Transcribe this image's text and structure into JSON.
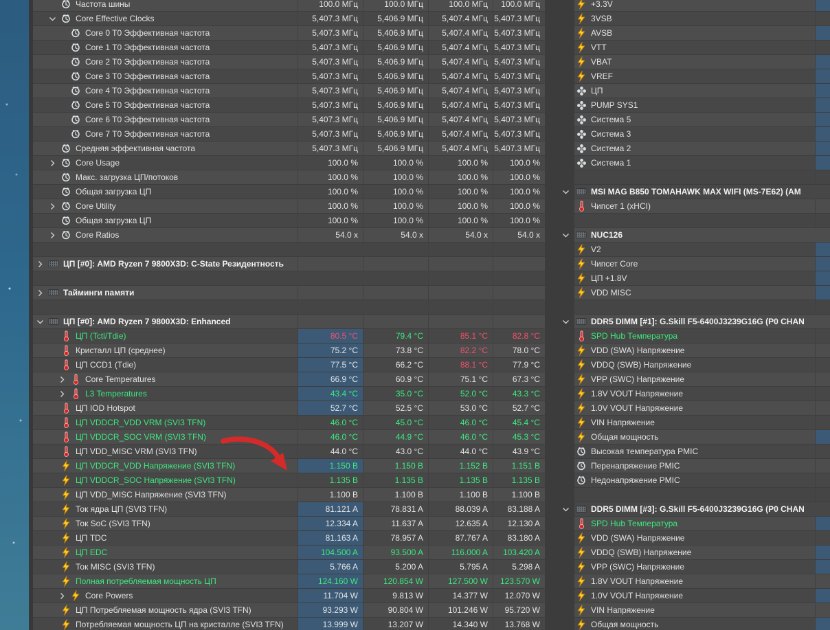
{
  "app": "HWiNFO64 sensor status (Russian locale)",
  "colors": {
    "row_light": "#4d4d4d",
    "row_dark": "#474747",
    "highlight_cell": "#3c5a76",
    "text_default": "#e3e3e3",
    "text_green": "#3ce97e",
    "text_red": "#f2516a",
    "annotation_arrow": "#d42a2a"
  },
  "left_table": {
    "rows": [
      {
        "type": "sensor",
        "icon": "clock",
        "level": "top",
        "label": "Частота шины",
        "values": [
          "100.0 МГц",
          "100.0 МГц",
          "100.0 МГц",
          "100.0 МГц"
        ]
      },
      {
        "type": "sensor",
        "icon": "clock",
        "level": "top",
        "chevron": "expanded",
        "label": "Core Effective Clocks",
        "values": [
          "5,407.3 МГц",
          "5,406.9 МГц",
          "5,407.4 МГц",
          "5,407.3 МГц"
        ]
      },
      {
        "type": "sensor",
        "icon": "clock",
        "level": "child",
        "label": "Core 0 T0 Эффективная частота",
        "values": [
          "5,407.3 МГц",
          "5,406.9 МГц",
          "5,407.4 МГц",
          "5,407.3 МГц"
        ]
      },
      {
        "type": "sensor",
        "icon": "clock",
        "level": "child",
        "label": "Core 1 T0 Эффективная частота",
        "values": [
          "5,407.3 МГц",
          "5,406.9 МГц",
          "5,407.4 МГц",
          "5,407.3 МГц"
        ]
      },
      {
        "type": "sensor",
        "icon": "clock",
        "level": "child",
        "label": "Core 2 T0 Эффективная частота",
        "values": [
          "5,407.3 МГц",
          "5,406.9 МГц",
          "5,407.4 МГц",
          "5,407.3 МГц"
        ]
      },
      {
        "type": "sensor",
        "icon": "clock",
        "level": "child",
        "label": "Core 3 T0 Эффективная частота",
        "values": [
          "5,407.3 МГц",
          "5,406.9 МГц",
          "5,407.4 МГц",
          "5,407.3 МГц"
        ]
      },
      {
        "type": "sensor",
        "icon": "clock",
        "level": "child",
        "label": "Core 4 T0 Эффективная частота",
        "values": [
          "5,407.3 МГц",
          "5,406.9 МГц",
          "5,407.4 МГц",
          "5,407.3 МГц"
        ]
      },
      {
        "type": "sensor",
        "icon": "clock",
        "level": "child",
        "label": "Core 5 T0 Эффективная частота",
        "values": [
          "5,407.3 МГц",
          "5,406.9 МГц",
          "5,407.4 МГц",
          "5,407.3 МГц"
        ]
      },
      {
        "type": "sensor",
        "icon": "clock",
        "level": "child",
        "label": "Core 6 T0 Эффективная частота",
        "values": [
          "5,407.3 МГц",
          "5,406.9 МГц",
          "5,407.4 МГц",
          "5,407.3 МГц"
        ]
      },
      {
        "type": "sensor",
        "icon": "clock",
        "level": "child",
        "label": "Core 7 T0 Эффективная частота",
        "values": [
          "5,407.3 МГц",
          "5,406.9 МГц",
          "5,407.4 МГц",
          "5,407.3 МГц"
        ]
      },
      {
        "type": "sensor",
        "icon": "clock",
        "level": "top",
        "label": "Средняя эффективная частота",
        "values": [
          "5,407.3 МГц",
          "5,406.9 МГц",
          "5,407.4 МГц",
          "5,407.3 МГц"
        ]
      },
      {
        "type": "sensor",
        "icon": "clock",
        "level": "top",
        "chevron": "collapsed",
        "label": "Core Usage",
        "values": [
          "100.0 %",
          "100.0 %",
          "100.0 %",
          "100.0 %"
        ]
      },
      {
        "type": "sensor",
        "icon": "clock",
        "level": "top",
        "label": "Макс. загрузка ЦП/потоков",
        "values": [
          "100.0 %",
          "100.0 %",
          "100.0 %",
          "100.0 %"
        ]
      },
      {
        "type": "sensor",
        "icon": "clock",
        "level": "top",
        "label": "Общая загрузка ЦП",
        "values": [
          "100.0 %",
          "100.0 %",
          "100.0 %",
          "100.0 %"
        ]
      },
      {
        "type": "sensor",
        "icon": "clock",
        "level": "top",
        "chevron": "collapsed",
        "label": "Core Utility",
        "values": [
          "100.0 %",
          "100.0 %",
          "100.0 %",
          "100.0 %"
        ]
      },
      {
        "type": "sensor",
        "icon": "clock",
        "level": "top",
        "label": "Общая загрузка ЦП",
        "values": [
          "100.0 %",
          "100.0 %",
          "100.0 %",
          "100.0 %"
        ]
      },
      {
        "type": "sensor",
        "icon": "clock",
        "level": "top",
        "chevron": "collapsed",
        "label": "Core Ratios",
        "values": [
          "54.0 x",
          "54.0 x",
          "54.0 x",
          "54.0 x"
        ]
      },
      {
        "type": "spacer"
      },
      {
        "type": "section",
        "icon": "chip",
        "chevron": "collapsed",
        "label": "ЦП [#0]: AMD Ryzen 7 9800X3D: C-State Резидентность"
      },
      {
        "type": "spacer"
      },
      {
        "type": "section",
        "icon": "chip",
        "chevron": "collapsed",
        "label": "Тайминги памяти"
      },
      {
        "type": "spacer"
      },
      {
        "type": "section",
        "icon": "chip",
        "chevron": "expanded",
        "label": "ЦП [#0]: AMD Ryzen 7 9800X3D: Enhanced"
      },
      {
        "type": "sensor",
        "icon": "thermometer",
        "level": "top",
        "color": "green",
        "highlight": true,
        "label": "ЦП (Tctl/Tdie)",
        "values": [
          "80.5 °C",
          "79.4 °C",
          "85.1 °C",
          "82.8 °C"
        ],
        "value_colors": [
          "red",
          "green",
          "red",
          "red"
        ]
      },
      {
        "type": "sensor",
        "icon": "thermometer",
        "level": "top",
        "highlight": true,
        "label": "Кристалл ЦП (среднее)",
        "values": [
          "75.2 °C",
          "73.8 °C",
          "82.2 °C",
          "78.0 °C"
        ],
        "value_colors": [
          null,
          null,
          "red",
          null
        ]
      },
      {
        "type": "sensor",
        "icon": "thermometer",
        "level": "top",
        "highlight": true,
        "label": "ЦП CCD1 (Tdie)",
        "values": [
          "77.5 °C",
          "66.2 °C",
          "88.1 °C",
          "77.9 °C"
        ],
        "value_colors": [
          null,
          null,
          "red",
          null
        ]
      },
      {
        "type": "sensor",
        "icon": "thermometer",
        "level": "child",
        "chevron": "collapsed",
        "highlight": true,
        "label": "Core Temperatures",
        "values": [
          "66.9 °C",
          "60.9 °C",
          "75.1 °C",
          "67.3 °C"
        ]
      },
      {
        "type": "sensor",
        "icon": "thermometer",
        "level": "child",
        "chevron": "collapsed",
        "color": "green",
        "highlight": true,
        "label": "L3 Temperatures",
        "values": [
          "43.4 °C",
          "35.0 °C",
          "52.0 °C",
          "43.3 °C"
        ]
      },
      {
        "type": "sensor",
        "icon": "thermometer",
        "level": "top",
        "highlight": true,
        "label": "ЦП IOD Hotspot",
        "values": [
          "52.7 °C",
          "52.5 °C",
          "53.0 °C",
          "52.7 °C"
        ]
      },
      {
        "type": "sensor",
        "icon": "thermometer",
        "level": "top",
        "color": "green",
        "label": "ЦП VDDCR_VDD VRM (SVI3 TFN)",
        "values": [
          "46.0 °C",
          "45.0 °C",
          "46.0 °C",
          "45.4 °C"
        ]
      },
      {
        "type": "sensor",
        "icon": "thermometer",
        "level": "top",
        "color": "green",
        "label": "ЦП VDDCR_SOC VRM (SVI3 TFN)",
        "values": [
          "46.0 °C",
          "44.9 °C",
          "46.0 °C",
          "45.3 °C"
        ]
      },
      {
        "type": "sensor",
        "icon": "thermometer",
        "level": "top",
        "label": "ЦП VDD_MISC VRM (SVI3 TFN)",
        "values": [
          "44.0 °C",
          "43.0 °C",
          "44.0 °C",
          "43.9 °C"
        ]
      },
      {
        "type": "sensor",
        "icon": "bolt",
        "level": "top",
        "color": "green",
        "highlight": true,
        "label": "ЦП VDDCR_VDD Напряжение (SVI3 TFN)",
        "values": [
          "1.150 В",
          "1.150 В",
          "1.152 В",
          "1.151 В"
        ]
      },
      {
        "type": "sensor",
        "icon": "bolt",
        "level": "top",
        "color": "green",
        "label": "ЦП VDDCR_SOC Напряжение (SVI3 TFN)",
        "values": [
          "1.135 В",
          "1.135 В",
          "1.135 В",
          "1.135 В"
        ]
      },
      {
        "type": "sensor",
        "icon": "bolt",
        "level": "top",
        "label": "ЦП VDD_MISC Напряжение (SVI3 TFN)",
        "values": [
          "1.100 В",
          "1.100 В",
          "1.100 В",
          "1.100 В"
        ]
      },
      {
        "type": "sensor",
        "icon": "bolt",
        "level": "top",
        "highlight": true,
        "label": "Ток ядра ЦП (SVI3 TFN)",
        "values": [
          "81.121 A",
          "78.831 A",
          "88.039 A",
          "83.188 A"
        ]
      },
      {
        "type": "sensor",
        "icon": "bolt",
        "level": "top",
        "highlight": true,
        "label": "Ток SoC (SVI3 TFN)",
        "values": [
          "12.334 A",
          "11.637 A",
          "12.635 A",
          "12.130 A"
        ]
      },
      {
        "type": "sensor",
        "icon": "bolt",
        "level": "top",
        "highlight": true,
        "label": "ЦП TDC",
        "values": [
          "81.163 A",
          "78.957 A",
          "87.767 A",
          "83.180 A"
        ]
      },
      {
        "type": "sensor",
        "icon": "bolt",
        "level": "top",
        "color": "green",
        "highlight": true,
        "label": "ЦП EDC",
        "values": [
          "104.500 A",
          "93.500 A",
          "116.000 A",
          "103.420 A"
        ]
      },
      {
        "type": "sensor",
        "icon": "bolt",
        "level": "top",
        "highlight": true,
        "label": "Ток MISC (SVI3 TFN)",
        "values": [
          "5.766 A",
          "5.200 A",
          "5.795 A",
          "5.298 A"
        ]
      },
      {
        "type": "sensor",
        "icon": "bolt",
        "level": "top",
        "color": "green",
        "highlight": true,
        "label": "Полная потребляемая мощность ЦП",
        "values": [
          "124.160 W",
          "120.854 W",
          "127.500 W",
          "123.570 W"
        ]
      },
      {
        "type": "sensor",
        "icon": "bolt",
        "level": "child",
        "chevron": "collapsed",
        "highlight": true,
        "label": "Core Powers",
        "values": [
          "11.704 W",
          "9.813 W",
          "14.377 W",
          "12.070 W"
        ]
      },
      {
        "type": "sensor",
        "icon": "bolt",
        "level": "top",
        "highlight": true,
        "label": "ЦП Потребляемая мощность ядра (SVI3 TFN)",
        "values": [
          "93.293 W",
          "90.804 W",
          "101.246 W",
          "95.720 W"
        ]
      },
      {
        "type": "sensor",
        "icon": "bolt",
        "level": "top",
        "highlight": true,
        "label": "Потребляемая мощность ЦП на кристалле (SVI3 TFN)",
        "values": [
          "13.999 W",
          "13.207 W",
          "14.340 W",
          "13.768 W"
        ]
      }
    ]
  },
  "right_panel": {
    "rows": [
      {
        "type": "sensor",
        "icon": "bolt",
        "label": "+3.3V",
        "edge": "blue"
      },
      {
        "type": "sensor",
        "icon": "bolt",
        "label": "3VSB"
      },
      {
        "type": "sensor",
        "icon": "bolt",
        "label": "AVSB",
        "edge": "blue"
      },
      {
        "type": "sensor",
        "icon": "bolt",
        "label": "VTT"
      },
      {
        "type": "sensor",
        "icon": "bolt",
        "label": "VBAT",
        "edge": "blue"
      },
      {
        "type": "sensor",
        "icon": "bolt",
        "label": "VREF",
        "edge": "blue"
      },
      {
        "type": "sensor",
        "icon": "fan",
        "label": "ЦП",
        "edge": "blue"
      },
      {
        "type": "sensor",
        "icon": "fan",
        "label": "PUMP SYS1",
        "edge": "blue"
      },
      {
        "type": "sensor",
        "icon": "fan",
        "label": "Система 5",
        "edge": "blue"
      },
      {
        "type": "sensor",
        "icon": "fan",
        "label": "Система 3",
        "edge": "blue"
      },
      {
        "type": "sensor",
        "icon": "fan",
        "label": "Система 2",
        "edge": "blue"
      },
      {
        "type": "sensor",
        "icon": "fan",
        "label": "Система 1",
        "edge": "blue"
      },
      {
        "type": "spacer"
      },
      {
        "type": "section",
        "icon": "chip",
        "chevron": "expanded",
        "label": "MSI MAG B850 TOMAHAWK MAX WIFI (MS-7E62) (AM"
      },
      {
        "type": "sensor",
        "icon": "thermometer",
        "label": "Чипсет 1 (xHCI)"
      },
      {
        "type": "spacer"
      },
      {
        "type": "section",
        "icon": "chip",
        "chevron": "expanded",
        "label": "NUC126"
      },
      {
        "type": "sensor",
        "icon": "bolt",
        "label": "V2",
        "edge": "blue"
      },
      {
        "type": "sensor",
        "icon": "bolt",
        "label": "Чипсет Core",
        "edge": "blue"
      },
      {
        "type": "sensor",
        "icon": "bolt",
        "label": "ЦП +1.8V",
        "edge": "blue"
      },
      {
        "type": "sensor",
        "icon": "bolt",
        "label": "VDD MISC",
        "edge": "blue"
      },
      {
        "type": "spacer"
      },
      {
        "type": "section",
        "icon": "chip",
        "chevron": "expanded",
        "label": "DDR5 DIMM [#1]: G.Skill F5-6400J3239G16G (P0 CHAN"
      },
      {
        "type": "sensor",
        "icon": "thermometer",
        "color": "green",
        "label": "SPD Hub Температура"
      },
      {
        "type": "sensor",
        "icon": "bolt",
        "label": "VDD (SWA) Напряжение"
      },
      {
        "type": "sensor",
        "icon": "bolt",
        "label": "VDDQ (SWB) Напряжение"
      },
      {
        "type": "sensor",
        "icon": "bolt",
        "label": "VPP (SWC) Напряжение"
      },
      {
        "type": "sensor",
        "icon": "bolt",
        "label": "1.8V VOUT Напряжение"
      },
      {
        "type": "sensor",
        "icon": "bolt",
        "label": "1.0V VOUT Напряжение"
      },
      {
        "type": "sensor",
        "icon": "bolt",
        "label": "VIN Напряжение"
      },
      {
        "type": "sensor",
        "icon": "bolt",
        "label": "Общая мощность",
        "edge": "blue"
      },
      {
        "type": "sensor",
        "icon": "clock",
        "label": "Высокая температура PMIC"
      },
      {
        "type": "sensor",
        "icon": "clock",
        "label": "Перенапряжение PMIC"
      },
      {
        "type": "sensor",
        "icon": "clock",
        "label": "Недонапряжение PMIC"
      },
      {
        "type": "spacer"
      },
      {
        "type": "section",
        "icon": "chip",
        "chevron": "expanded",
        "label": "DDR5 DIMM [#3]: G.Skill F5-6400J3239G16G (P0 CHAN"
      },
      {
        "type": "sensor",
        "icon": "thermometer",
        "color": "green",
        "label": "SPD Hub Температура",
        "edge": "blue"
      },
      {
        "type": "sensor",
        "icon": "bolt",
        "label": "VDD (SWA) Напряжение"
      },
      {
        "type": "sensor",
        "icon": "bolt",
        "label": "VDDQ (SWB) Напряжение",
        "edge": "blue"
      },
      {
        "type": "sensor",
        "icon": "bolt",
        "label": "VPP (SWC) Напряжение",
        "edge": "blue"
      },
      {
        "type": "sensor",
        "icon": "bolt",
        "label": "1.8V VOUT Напряжение"
      },
      {
        "type": "sensor",
        "icon": "bolt",
        "label": "1.0V VOUT Напряжение",
        "edge": "blue"
      },
      {
        "type": "sensor",
        "icon": "bolt",
        "label": "VIN Напряжение"
      },
      {
        "type": "sensor",
        "icon": "bolt",
        "label": "Общая мощность",
        "edge": "blue"
      }
    ]
  },
  "annotation": {
    "type": "hand-drawn-arrow",
    "color": "#d42a2a"
  }
}
